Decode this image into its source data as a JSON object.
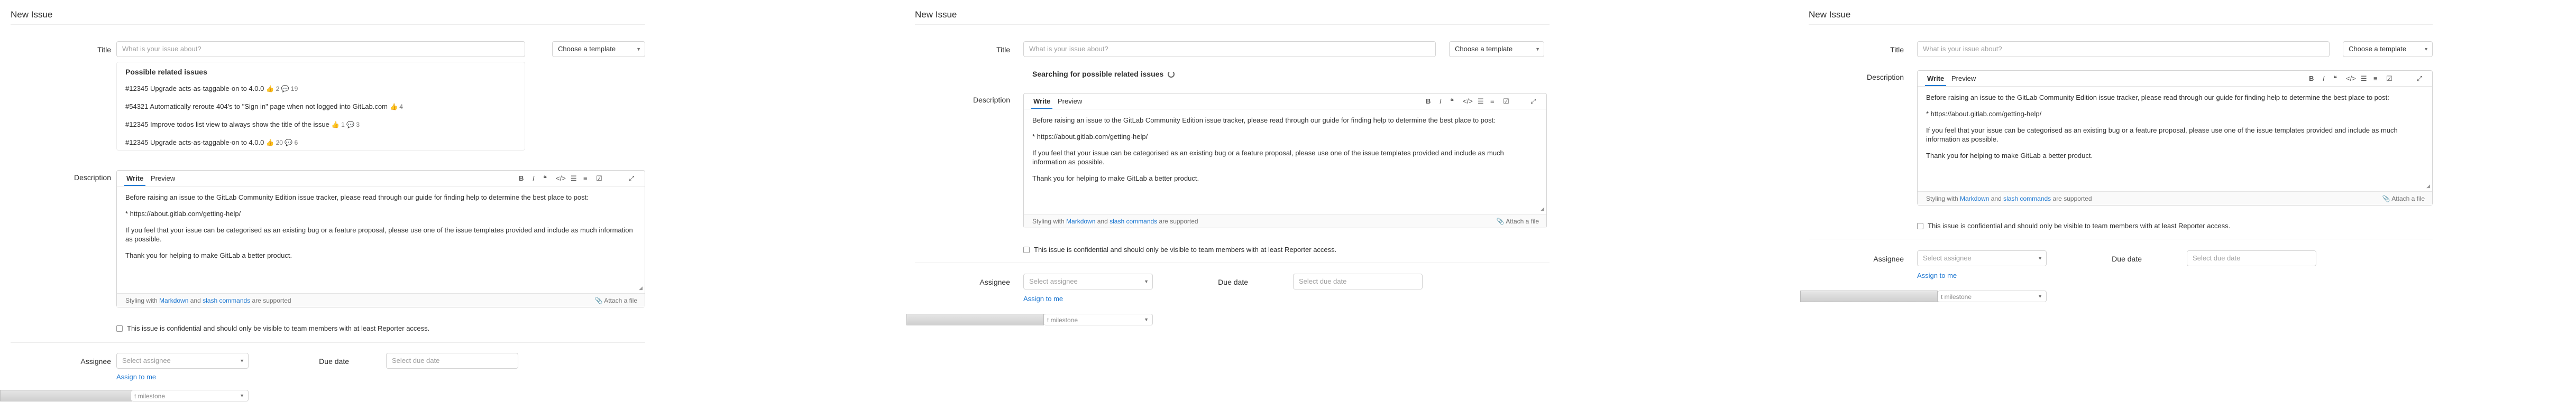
{
  "panels": [
    {
      "page_title": "New Issue",
      "title_label": "Title",
      "title_placeholder": "What is your issue about?",
      "template_label": "Choose a template",
      "related": {
        "heading": "Possible related issues",
        "items": [
          {
            "text": "#12345 Upgrade acts-as-taggable-on to 4.0.0",
            "meta": "👍 2  💬 19"
          },
          {
            "text": "#54321 Automatically reroute 404's to \"Sign in\" page when not logged into GitLab.com",
            "meta": "👍 4"
          },
          {
            "text": "#12345 Improve todos list view to always show the title of the issue",
            "meta": "👍 1  💬 3"
          },
          {
            "text": "#12345 Upgrade acts-as-taggable-on to 4.0.0",
            "meta": "👍 20  💬 6"
          }
        ]
      },
      "description_label": "Description",
      "tab_write": "Write",
      "tab_preview": "Preview",
      "body": [
        "Before raising an issue to the GitLab Community Edition issue tracker, please read through our guide for finding help to determine the best place to post:",
        "* https://about.gitlab.com/getting-help/",
        "If you feel that your issue can be categorised as an existing bug or a feature proposal, please use one of the issue templates provided and include as much information as possible.",
        "Thank you for helping to make GitLab a better product."
      ],
      "styling_prefix": "Styling with",
      "markdown": "Markdown",
      "and": "and",
      "slash_commands": "slash commands",
      "supported": "are supported",
      "attach": "Attach a file",
      "confidential": "This issue is confidential and should only be visible to team members with at least Reporter access.",
      "assignee_label": "Assignee",
      "assignee_placeholder": "Select assignee",
      "assign_to_me": "Assign to me",
      "due_label": "Due date",
      "due_placeholder": "Select due date",
      "milestone": "t milestone"
    },
    {
      "page_title": "New Issue",
      "title_label": "Title",
      "title_placeholder": "What is your issue about?",
      "template_label": "Choose a template",
      "searching": "Searching for possible related issues",
      "description_label": "Description",
      "tab_write": "Write",
      "tab_preview": "Preview",
      "body": [
        "Before raising an issue to the GitLab Community Edition issue tracker, please read through our guide for finding help to determine the best place to post:",
        "* https://about.gitlab.com/getting-help/",
        "If you feel that your issue can be categorised as an existing bug or a feature proposal, please use one of the issue templates provided and include as much information as possible.",
        "Thank you for helping to make GitLab a better product."
      ],
      "styling_prefix": "Styling with",
      "markdown": "Markdown",
      "and": "and",
      "slash_commands": "slash commands",
      "supported": "are supported",
      "attach": "Attach a file",
      "confidential": "This issue is confidential and should only be visible to team members with at least Reporter access.",
      "assignee_label": "Assignee",
      "assignee_placeholder": "Select assignee",
      "assign_to_me": "Assign to me",
      "due_label": "Due date",
      "due_placeholder": "Select due date",
      "milestone": "t milestone"
    },
    {
      "page_title": "New Issue",
      "title_label": "Title",
      "title_placeholder": "What is your issue about?",
      "template_label": "Choose a template",
      "description_label": "Description",
      "tab_write": "Write",
      "tab_preview": "Preview",
      "body": [
        "Before raising an issue to the GitLab Community Edition issue tracker, please read through our guide for finding help to determine the best place to post:",
        "* https://about.gitlab.com/getting-help/",
        "If you feel that your issue can be categorised as an existing bug or a feature proposal, please use one of the issue templates provided and include as much information as possible.",
        "Thank you for helping to make GitLab a better product."
      ],
      "styling_prefix": "Styling with",
      "markdown": "Markdown",
      "and": "and",
      "slash_commands": "slash commands",
      "supported": "are supported",
      "attach": "Attach a file",
      "confidential": "This issue is confidential and should only be visible to team members with at least Reporter access.",
      "assignee_label": "Assignee",
      "assignee_placeholder": "Select assignee",
      "assign_to_me": "Assign to me",
      "due_label": "Due date",
      "due_placeholder": "Select due date",
      "milestone": "t milestone"
    }
  ],
  "toolbar_icons": [
    "bold-icon",
    "italic-icon",
    "quote-icon",
    "code-icon",
    "bullet-list-icon",
    "numbered-list-icon",
    "task-list-icon",
    "fullscreen-icon"
  ],
  "colors": {
    "link": "#1f78d1",
    "border": "#d4d4d4",
    "text": "#303030"
  }
}
